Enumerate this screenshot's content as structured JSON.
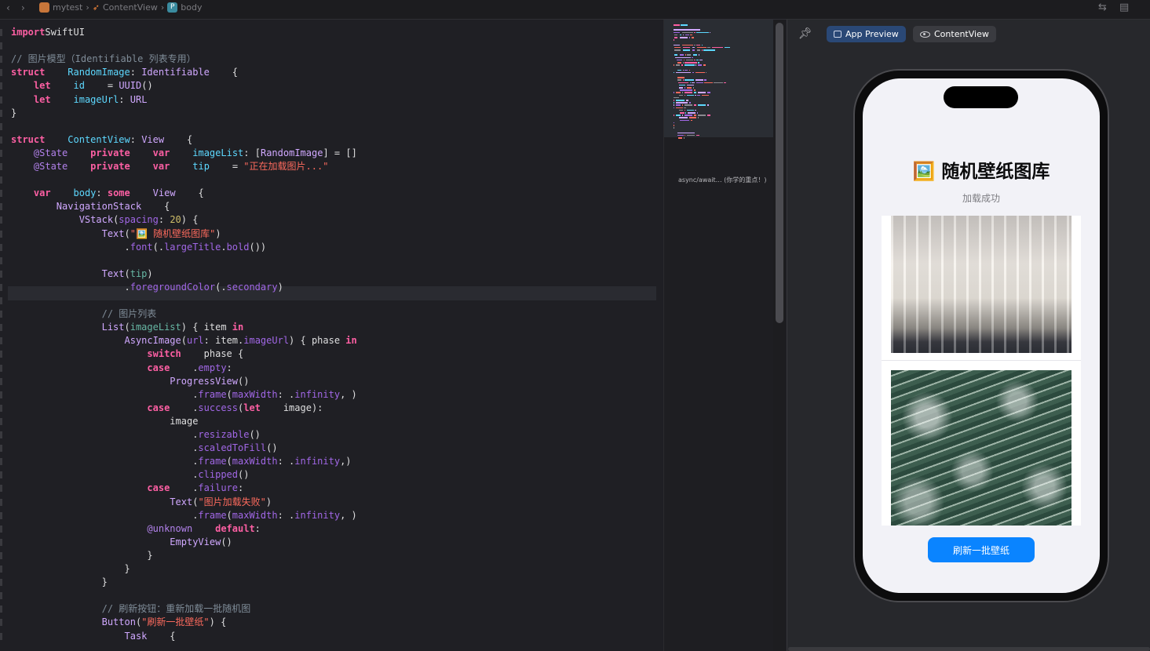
{
  "breadcrumb": {
    "project": "mytest",
    "file": "ContentView",
    "symbol": "body",
    "symbol_badge": "P"
  },
  "code_lines": [
    [
      [
        "kw",
        "import"
      ],
      [
        "",
        "SwiftUI"
      ]
    ],
    [],
    [
      [
        "cm",
        "// 图片模型（Identifiable 列表专用）"
      ]
    ],
    [
      [
        "kw",
        "struct"
      ],
      [
        "",
        " "
      ],
      [
        "ty",
        "RandomImage"
      ],
      [
        "",
        ": "
      ],
      [
        "cl",
        "Identifiable"
      ],
      [
        "",
        " {"
      ]
    ],
    [
      [
        "",
        " "
      ],
      [
        "kw",
        "let"
      ],
      [
        "",
        " "
      ],
      [
        "ty",
        "id"
      ],
      [
        "",
        " = "
      ],
      [
        "cl",
        "UUID"
      ],
      [
        "",
        "()"
      ]
    ],
    [
      [
        "",
        " "
      ],
      [
        "kw",
        "let"
      ],
      [
        "",
        " "
      ],
      [
        "ty",
        "imageUrl"
      ],
      [
        "",
        ": "
      ],
      [
        "cl",
        "URL"
      ]
    ],
    [
      [
        "",
        "}"
      ]
    ],
    [],
    [
      [
        "kw",
        "struct"
      ],
      [
        "",
        " "
      ],
      [
        "ty",
        "ContentView"
      ],
      [
        "",
        ": "
      ],
      [
        "cl",
        "View"
      ],
      [
        "",
        " {"
      ]
    ],
    [
      [
        "",
        " "
      ],
      [
        "at",
        "@State"
      ],
      [
        "",
        " "
      ],
      [
        "kw",
        "private"
      ],
      [
        "",
        " "
      ],
      [
        "kw",
        "var"
      ],
      [
        "",
        " "
      ],
      [
        "ty",
        "imageList"
      ],
      [
        "",
        ": ["
      ],
      [
        "cl",
        "RandomImage"
      ],
      [
        "",
        "] = []"
      ]
    ],
    [
      [
        "",
        " "
      ],
      [
        "at",
        "@State"
      ],
      [
        "",
        " "
      ],
      [
        "kw",
        "private"
      ],
      [
        "",
        " "
      ],
      [
        "kw",
        "var"
      ],
      [
        "",
        " "
      ],
      [
        "ty",
        "tip"
      ],
      [
        "",
        " = "
      ],
      [
        "st",
        "\"正在加载图片...\""
      ]
    ],
    [],
    [
      [
        "",
        " "
      ],
      [
        "kw",
        "var"
      ],
      [
        "",
        " "
      ],
      [
        "ty",
        "body"
      ],
      [
        "",
        ": "
      ],
      [
        "kw",
        "some"
      ],
      [
        "",
        " "
      ],
      [
        "cl",
        "View"
      ],
      [
        "",
        " {"
      ]
    ],
    [
      [
        "",
        "  "
      ],
      [
        "cl",
        "NavigationStack"
      ],
      [
        "",
        " {"
      ]
    ],
    [
      [
        "",
        "   "
      ],
      [
        "cl",
        "VStack"
      ],
      [
        "",
        "("
      ],
      [
        "pr",
        "spacing"
      ],
      [
        "",
        ": "
      ],
      [
        "nm",
        "20"
      ],
      [
        "",
        ") {"
      ]
    ],
    [
      [
        "",
        "    "
      ],
      [
        "cl",
        "Text"
      ],
      [
        "",
        "("
      ],
      [
        "st",
        "\"🖼️ 随机壁纸图库\""
      ],
      [
        "",
        ")"
      ]
    ],
    [
      [
        "",
        "     ."
      ],
      [
        "pr",
        "font"
      ],
      [
        "",
        "(."
      ],
      [
        "pr",
        "largeTitle"
      ],
      [
        "",
        "."
      ],
      [
        "pr",
        "bold"
      ],
      [
        "",
        "())"
      ]
    ],
    [],
    [
      [
        "",
        "    "
      ],
      [
        "cl",
        "Text"
      ],
      [
        "",
        "("
      ],
      [
        "fn",
        "tip"
      ],
      [
        "",
        ")"
      ]
    ],
    [
      [
        "",
        "     ."
      ],
      [
        "pr",
        "foregroundColor"
      ],
      [
        "",
        "(."
      ],
      [
        "pr",
        "secondary"
      ],
      [
        "",
        ")"
      ]
    ],
    [],
    [
      [
        "",
        "    "
      ],
      [
        "cm",
        "// 图片列表"
      ]
    ],
    [
      [
        "",
        "    "
      ],
      [
        "cl",
        "List"
      ],
      [
        "",
        "("
      ],
      [
        "fn",
        "imageList"
      ],
      [
        "",
        ") { item "
      ],
      [
        "kw",
        "in"
      ]
    ],
    [
      [
        "",
        "     "
      ],
      [
        "cl",
        "AsyncImage"
      ],
      [
        "",
        "("
      ],
      [
        "pr",
        "url"
      ],
      [
        "",
        ": item."
      ],
      [
        "pr",
        "imageUrl"
      ],
      [
        "",
        ") { phase "
      ],
      [
        "kw",
        "in"
      ]
    ],
    [
      [
        "",
        "      "
      ],
      [
        "kw",
        "switch"
      ],
      [
        "",
        " phase {"
      ]
    ],
    [
      [
        "",
        "      "
      ],
      [
        "kw",
        "case"
      ],
      [
        "",
        " ."
      ],
      [
        "pr",
        "empty"
      ],
      [
        "",
        ":"
      ]
    ],
    [
      [
        "",
        "       "
      ],
      [
        "cl",
        "ProgressView"
      ],
      [
        "",
        "()"
      ]
    ],
    [
      [
        "",
        "        ."
      ],
      [
        "pr",
        "frame"
      ],
      [
        "",
        "("
      ],
      [
        "pr",
        "maxWidth"
      ],
      [
        "",
        ": ."
      ],
      [
        "pr",
        "infinity"
      ],
      [
        "",
        ", )"
      ]
    ],
    [
      [
        "",
        "      "
      ],
      [
        "kw",
        "case"
      ],
      [
        "",
        " ."
      ],
      [
        "pr",
        "success"
      ],
      [
        "",
        "("
      ],
      [
        "kw",
        "let"
      ],
      [
        "",
        " image):"
      ]
    ],
    [
      [
        "",
        "       image"
      ]
    ],
    [
      [
        "",
        "        ."
      ],
      [
        "pr",
        "resizable"
      ],
      [
        "",
        "()"
      ]
    ],
    [
      [
        "",
        "        ."
      ],
      [
        "pr",
        "scaledToFill"
      ],
      [
        "",
        "()"
      ]
    ],
    [
      [
        "",
        "        ."
      ],
      [
        "pr",
        "frame"
      ],
      [
        "",
        "("
      ],
      [
        "pr",
        "maxWidth"
      ],
      [
        "",
        ": ."
      ],
      [
        "pr",
        "infinity"
      ],
      [
        "",
        ",)"
      ]
    ],
    [
      [
        "",
        "        ."
      ],
      [
        "pr",
        "clipped"
      ],
      [
        "",
        "()"
      ]
    ],
    [
      [
        "",
        "      "
      ],
      [
        "kw",
        "case"
      ],
      [
        "",
        " ."
      ],
      [
        "pr",
        "failure"
      ],
      [
        "",
        ":"
      ]
    ],
    [
      [
        "",
        "       "
      ],
      [
        "cl",
        "Text"
      ],
      [
        "",
        "("
      ],
      [
        "st",
        "\"图片加载失败\""
      ],
      [
        "",
        ")"
      ]
    ],
    [
      [
        "",
        "        ."
      ],
      [
        "pr",
        "frame"
      ],
      [
        "",
        "("
      ],
      [
        "pr",
        "maxWidth"
      ],
      [
        "",
        ": ."
      ],
      [
        "pr",
        "infinity"
      ],
      [
        "",
        ", )"
      ]
    ],
    [
      [
        "",
        "      "
      ],
      [
        "at",
        "@unknown"
      ],
      [
        "",
        " "
      ],
      [
        "kw",
        "default"
      ],
      [
        "",
        ":"
      ]
    ],
    [
      [
        "",
        "       "
      ],
      [
        "cl",
        "EmptyView"
      ],
      [
        "",
        "()"
      ]
    ],
    [
      [
        "",
        "      }"
      ]
    ],
    [
      [
        "",
        "     }"
      ]
    ],
    [
      [
        "",
        "    }"
      ]
    ],
    [],
    [
      [
        "",
        "    "
      ],
      [
        "cm",
        "// 刷新按钮：重新加载一批随机图"
      ]
    ],
    [
      [
        "",
        "    "
      ],
      [
        "cl",
        "Button"
      ],
      [
        "",
        "("
      ],
      [
        "st",
        "\"刷新一批壁纸\""
      ],
      [
        "",
        ") {"
      ]
    ],
    [
      [
        "",
        "     "
      ],
      [
        "cl",
        "Task"
      ],
      [
        "",
        " {"
      ]
    ]
  ],
  "minimap_label": "async/await… (你学的重点！)",
  "preview_tabs": {
    "app_preview": "App Preview",
    "content_view": "ContentView"
  },
  "app": {
    "title": "🖼️ 随机壁纸图库",
    "tip": "加载成功",
    "refresh_button": "刷新一批壁纸"
  },
  "colors": {
    "accent": "#0a84ff",
    "editor_bg": "#1f1f24",
    "keyword": "#fc5fa3",
    "type": "#5dd8ff",
    "string": "#fc6a5d",
    "comment": "#7f8c98"
  }
}
